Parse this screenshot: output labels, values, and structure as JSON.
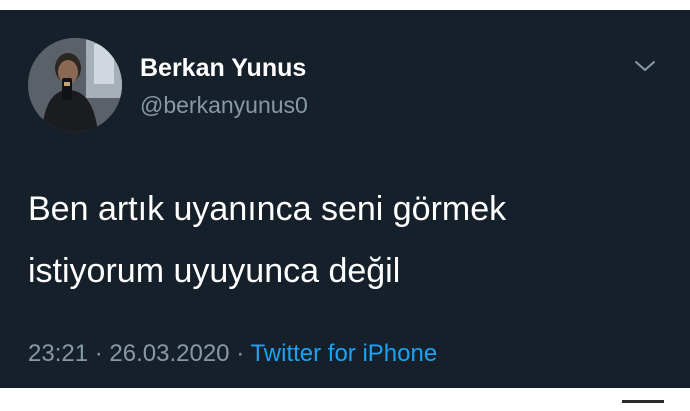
{
  "tweet": {
    "author": {
      "display_name": "Berkan Yunus",
      "handle": "@berkanyunus0",
      "avatar_icon": "profile-photo"
    },
    "text_lines": [
      "Ben artık uyanınca seni görmek",
      "istiyorum uyuyunca değil"
    ],
    "time": "23:21",
    "separator": "·",
    "date": "26.03.2020",
    "source": "Twitter for iPhone",
    "menu_icon": "chevron-down-icon"
  },
  "colors": {
    "card_background": "#15202b",
    "text_primary": "#ffffff",
    "text_secondary": "#8899a6",
    "link": "#1da1f2"
  }
}
